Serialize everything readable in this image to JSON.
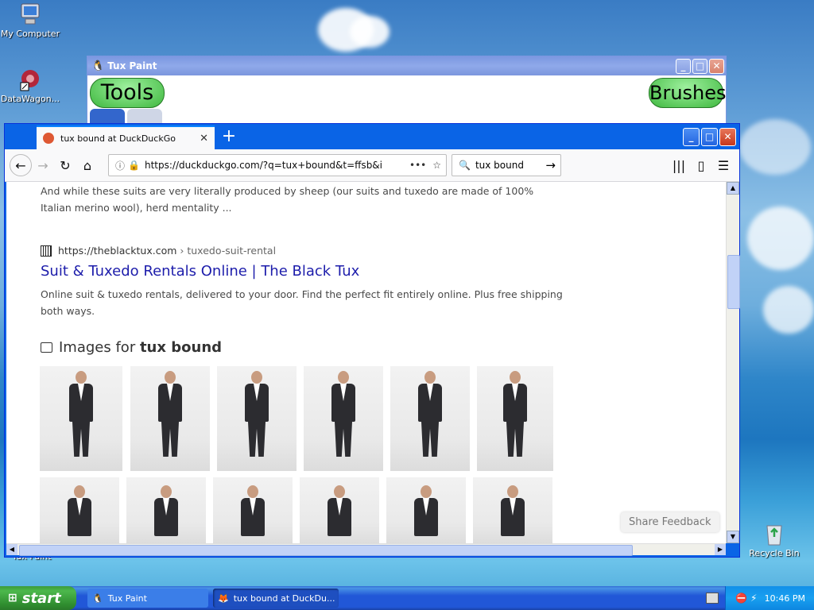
{
  "desktop": {
    "icons": [
      {
        "label": "My Computer"
      },
      {
        "label": "DataWagon..."
      },
      {
        "label": "Recycle Bin"
      },
      {
        "label": "Tux Paint"
      }
    ]
  },
  "tuxpaint": {
    "title": "Tux Paint",
    "tools_label": "Tools",
    "brushes_label": "Brushes"
  },
  "browser": {
    "tab_title": "tux bound at DuckDuckGo",
    "new_tab": "+",
    "url": "https://duckduckgo.com/?q=tux+bound&t=ffsb&i",
    "search_value": "tux bound",
    "content": {
      "prev_snippet": "And while these suits are very literally produced by sheep (our suits and tuxedo are made of 100% Italian merino wool), herd mentality ...",
      "result": {
        "url_domain": "https://theblacktux.com",
        "url_path": "› tuxedo-suit-rental",
        "title": "Suit & Tuxedo Rentals Online | The Black Tux",
        "snippet": "Online suit & tuxedo rentals, delivered to your door. Find the perfect fit entirely online. Plus free shipping both ways."
      },
      "images_heading_prefix": "Images for ",
      "images_heading_query": "tux bound",
      "share_feedback": "Share Feedback"
    }
  },
  "taskbar": {
    "start_label": "start",
    "tasks": [
      {
        "label": "Tux Paint"
      },
      {
        "label": "tux bound at DuckDu..."
      }
    ],
    "clock": "10:46 PM"
  },
  "colors": {
    "xp_blue": "#0a5ad8",
    "ddg_link": "#1d1dab",
    "tuxpaint_green": "#3fb83f"
  }
}
